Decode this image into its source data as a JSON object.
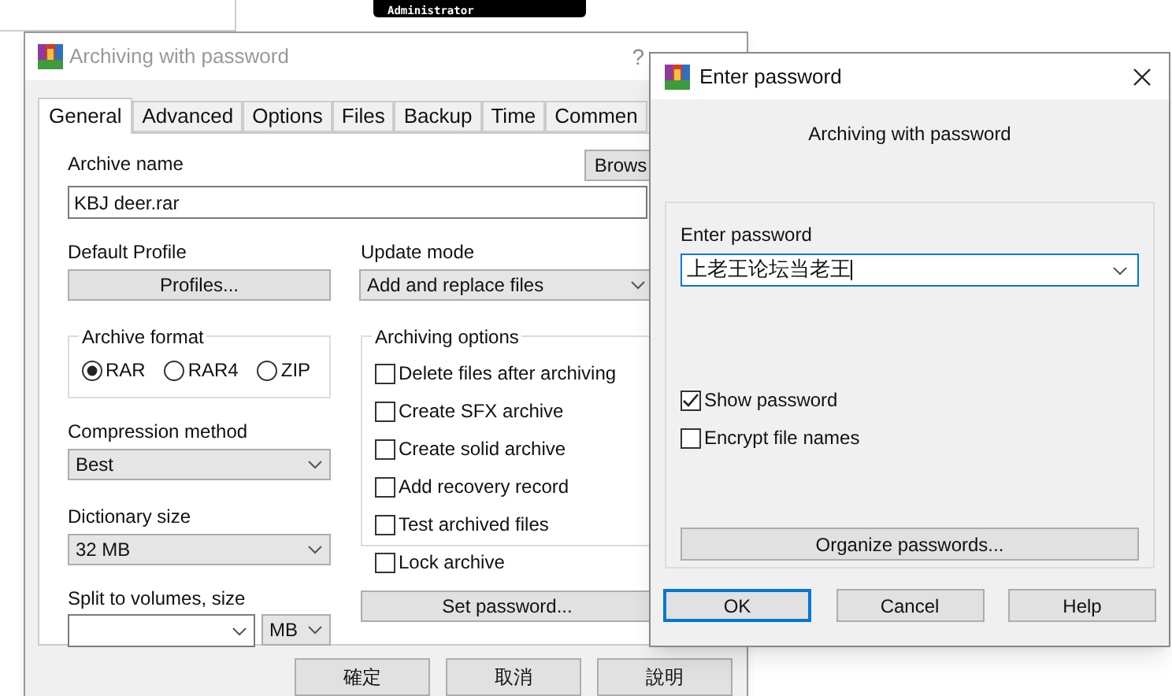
{
  "background": {
    "badge_text": "Administrator"
  },
  "main_dialog": {
    "title": "Archiving with password",
    "help_glyph": "?",
    "tabs": [
      {
        "label": "General",
        "selected": true
      },
      {
        "label": "Advanced",
        "selected": false
      },
      {
        "label": "Options",
        "selected": false
      },
      {
        "label": "Files",
        "selected": false
      },
      {
        "label": "Backup",
        "selected": false
      },
      {
        "label": "Time",
        "selected": false
      },
      {
        "label": "Commen",
        "selected": false
      }
    ],
    "archive_name": {
      "label": "Archive name",
      "value": "KBJ deer.rar",
      "browse_button": "Brows"
    },
    "default_profile": {
      "label": "Default Profile",
      "button": "Profiles..."
    },
    "update_mode": {
      "label": "Update mode",
      "value": "Add and replace files"
    },
    "archive_format": {
      "title": "Archive format",
      "options": [
        {
          "label": "RAR",
          "selected": true
        },
        {
          "label": "RAR4",
          "selected": false
        },
        {
          "label": "ZIP",
          "selected": false
        }
      ]
    },
    "compression_method": {
      "label": "Compression method",
      "value": "Best"
    },
    "dictionary_size": {
      "label": "Dictionary size",
      "value": "32 MB"
    },
    "archiving_options": {
      "title": "Archiving options",
      "items": [
        {
          "label": "Delete files after archiving",
          "checked": false
        },
        {
          "label": "Create SFX archive",
          "checked": false
        },
        {
          "label": "Create solid archive",
          "checked": false
        },
        {
          "label": "Add recovery record",
          "checked": false
        },
        {
          "label": "Test archived files",
          "checked": false
        },
        {
          "label": "Lock archive",
          "checked": false
        }
      ]
    },
    "split_volumes": {
      "label": "Split to volumes, size",
      "unit": "MB"
    },
    "set_password_button": "Set password...",
    "buttons": [
      "確定",
      "取消",
      "說明"
    ]
  },
  "password_dialog": {
    "title": "Enter password",
    "subtitle": "Archiving with password",
    "password": {
      "label": "Enter password",
      "value": "上老王论坛当老王"
    },
    "options": [
      {
        "label": "Show password",
        "checked": true
      },
      {
        "label": "Encrypt file names",
        "checked": false
      }
    ],
    "organize_button": "Organize passwords...",
    "buttons": [
      {
        "label": "OK",
        "selected": true
      },
      {
        "label": "Cancel",
        "selected": false
      },
      {
        "label": "Help",
        "selected": false
      }
    ]
  }
}
